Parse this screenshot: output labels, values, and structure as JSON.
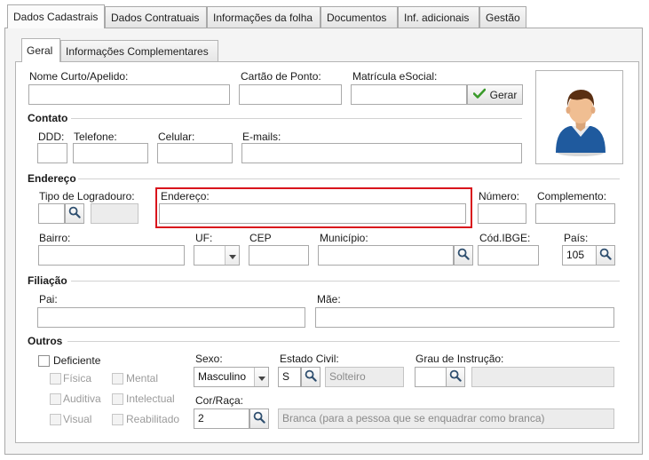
{
  "outer_tabs": [
    "Dados Cadastrais",
    "Dados Contratuais",
    "Informações da folha",
    "Documentos",
    "Inf. adicionais",
    "Gestão"
  ],
  "inner_tabs": [
    "Geral",
    "Informações Complementares"
  ],
  "top": {
    "nome_label": "Nome Curto/Apelido:",
    "cartao_label": "Cartão de Ponto:",
    "matricula_label": "Matrícula eSocial:",
    "gerar_label": "Gerar"
  },
  "contato": {
    "title": "Contato",
    "ddd": "DDD:",
    "telefone": "Telefone:",
    "celular": "Celular:",
    "emails": "E-mails:"
  },
  "endereco": {
    "title": "Endereço",
    "tipo_logradouro": "Tipo de Logradouro:",
    "endereco": "Endereço:",
    "numero": "Número:",
    "complemento": "Complemento:",
    "bairro": "Bairro:",
    "uf": "UF:",
    "cep": "CEP",
    "municipio": "Município:",
    "cod_ibge": "Cód.IBGE:",
    "pais": "País:",
    "pais_value": "105"
  },
  "filiacao": {
    "title": "Filiação",
    "pai": "Pai:",
    "mae": "Mãe:"
  },
  "outros": {
    "title": "Outros",
    "deficiente": "Deficiente",
    "fisica": "Física",
    "auditiva": "Auditiva",
    "visual": "Visual",
    "mental": "Mental",
    "intelectual": "Intelectual",
    "reabilitado": "Reabilitado",
    "sexo_label": "Sexo:",
    "sexo_value": "Masculino",
    "estado_civil_label": "Estado Civil:",
    "estado_civil_code": "S",
    "estado_civil_desc": "Solteiro",
    "grau_label": "Grau de Instrução:",
    "cor_label": "Cor/Raça:",
    "cor_code": "2",
    "cor_desc": "Branca (para a pessoa que se enquadrar como branca)"
  },
  "colors": {
    "highlight": "#d9141c",
    "check_green": "#3a9a2a"
  },
  "icons": [
    "search-icon",
    "checkmark-icon",
    "chevron-down-icon",
    "user-avatar-icon"
  ]
}
